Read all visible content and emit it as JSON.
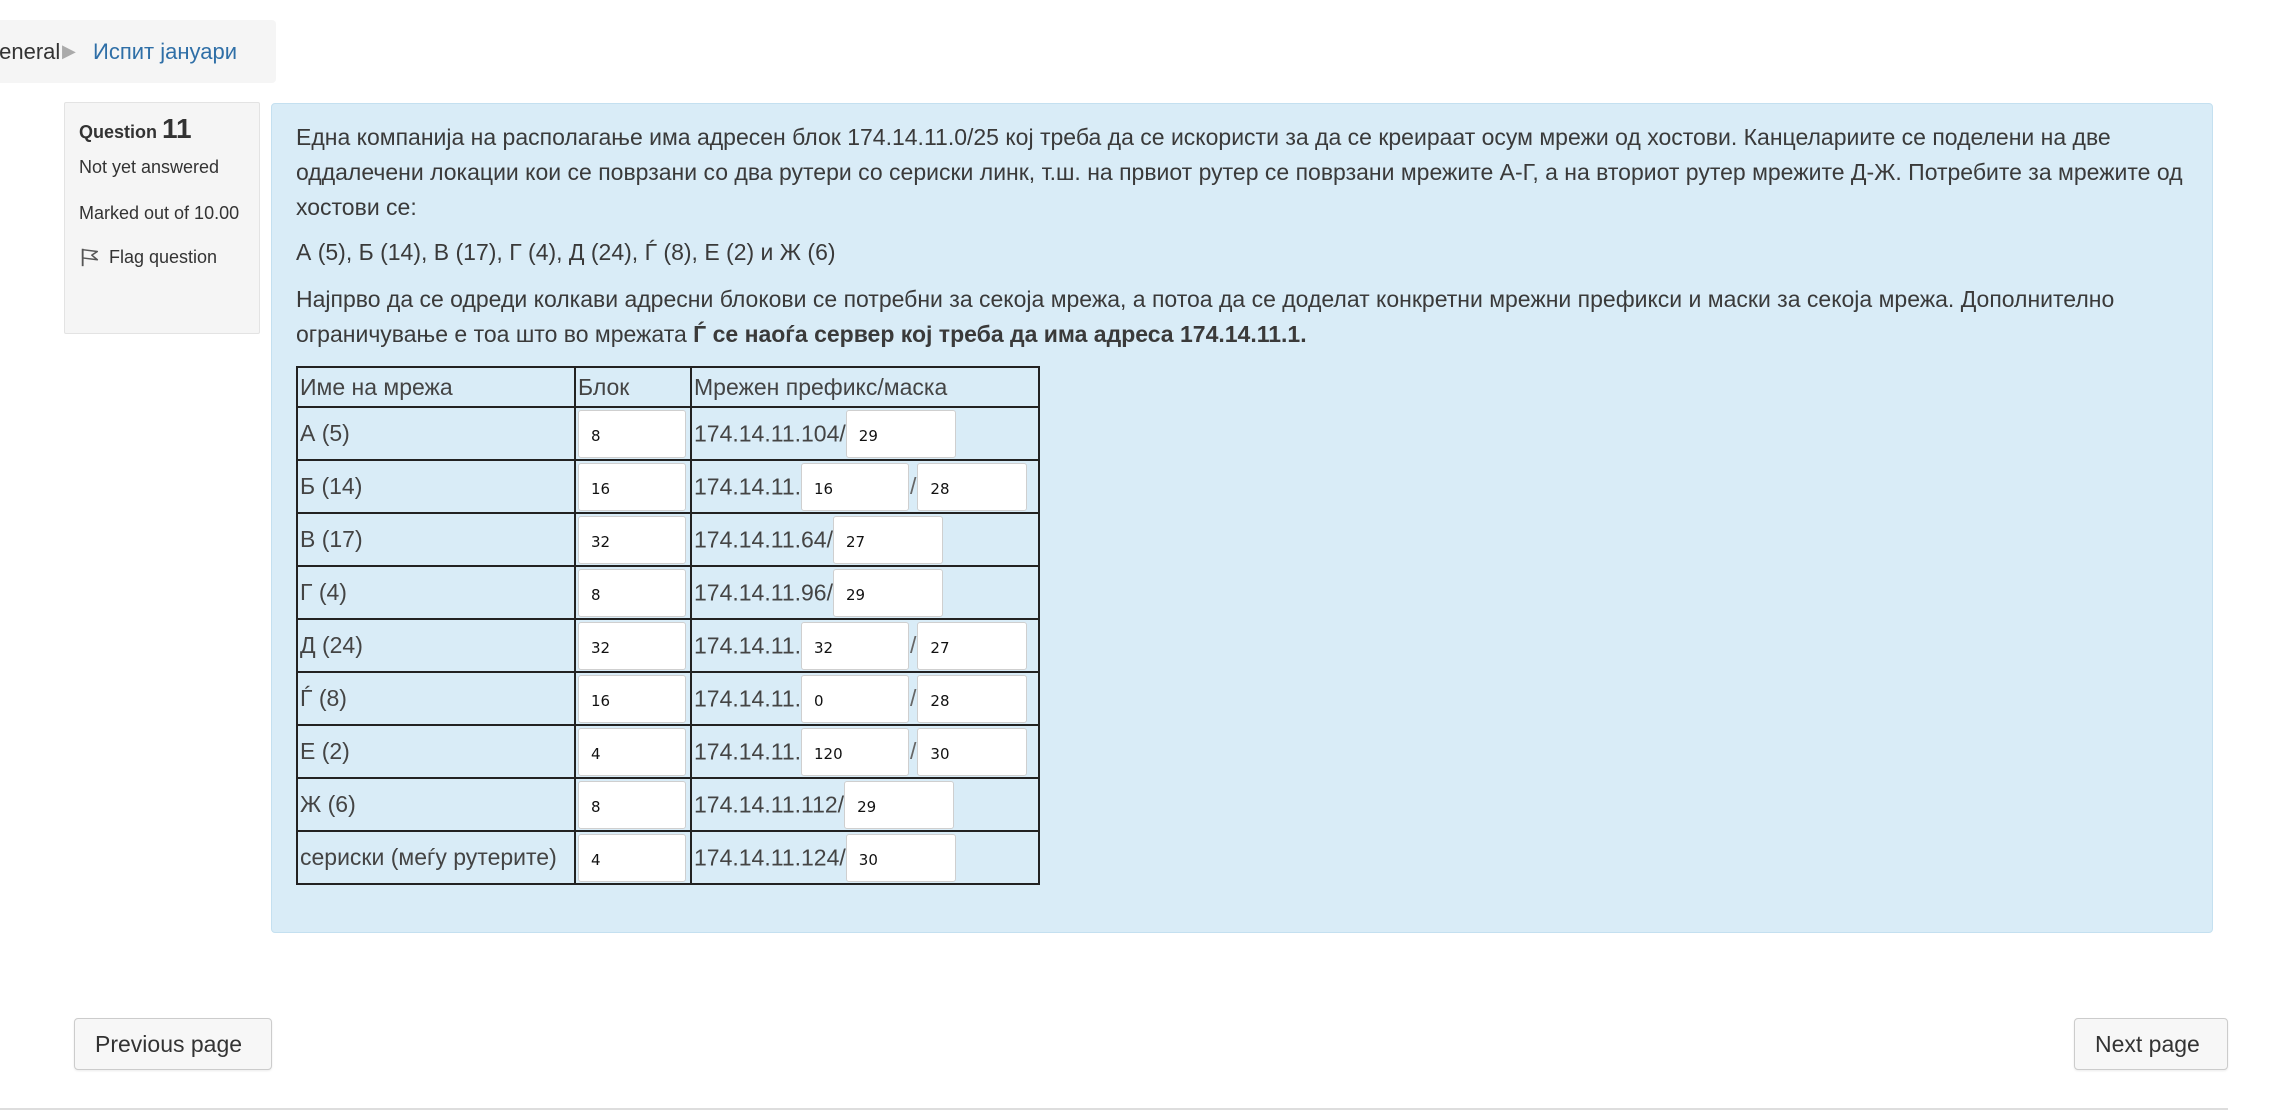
{
  "breadcrumb": {
    "previous": "General",
    "separator": "▶",
    "current": "Испит јануари"
  },
  "question_info": {
    "label": "Question",
    "number": "11",
    "state": "Not yet answered",
    "grade": "Marked out of 10.00",
    "flag_label": "Flag question",
    "flag_icon": "flag-icon"
  },
  "question": {
    "paragraph1": "Една компанија на располагање има адресен блок 174.14.11.0/25 кој треба да се искористи за да се креираат осум мрежи од хостови. Канцелариите се поделени на две оддалечени локации кои се поврзани со два рутери со сериски линк, т.ш. на првиот рутер се поврзани мрежите А-Г, а на вториот рутер мрежите Д-Ж. Потребите за мрежите од хостови се:",
    "paragraph2": "А (5), Б (14), В (17), Г (4), Д (24), Ѓ (8), Е (2) и Ж (6)",
    "paragraph3_text": "Најпрво да се одреди колкави адресни блокови се потребни за секоја мрежа, а потоа да се доделат конкретни мрежни префикси и маски за секоја мрежа. Дополнително ограничување е тоа што во мрежата ",
    "paragraph3_bold": "Ѓ се наоѓа сервер кој треба да има адреса 174.14.11.1."
  },
  "table": {
    "headers": [
      "Име на мрежа",
      "Блок",
      "Мрежен префикс/маска"
    ],
    "rows": [
      {
        "name": "А (5)",
        "block": "8",
        "prefix_text": "174.14.11.104/",
        "mask": "29"
      },
      {
        "name": "Б (14)",
        "block": "16",
        "prefix_text": "174.14.11.",
        "octet": "16",
        "mask": "28"
      },
      {
        "name": "В (17)",
        "block": "32",
        "prefix_text": "174.14.11.64/",
        "mask": "27"
      },
      {
        "name": "Г (4)",
        "block": "8",
        "prefix_text": "174.14.11.96/",
        "mask": "29"
      },
      {
        "name": "Д (24)",
        "block": "32",
        "prefix_text": "174.14.11.",
        "octet": "32",
        "mask": "27"
      },
      {
        "name": "Ѓ (8)",
        "block": "16",
        "prefix_text": "174.14.11.",
        "octet": "0",
        "mask": "28"
      },
      {
        "name": "Е (2)",
        "block": "4",
        "prefix_text": "174.14.11.",
        "octet": "120",
        "mask": "30"
      },
      {
        "name": "Ж (6)",
        "block": "8",
        "prefix_text": "174.14.11.112/",
        "mask": "29"
      },
      {
        "name": "сериски (меѓу рутерите)",
        "block": "4",
        "prefix_text": "174.14.11.124/",
        "mask": "30"
      }
    ],
    "slash": "/"
  },
  "navigation": {
    "previous_label": "Previous page",
    "next_label": "Next page"
  },
  "colors": {
    "content_bg": "#d9ecf7",
    "link": "#2f6fa7",
    "info_bg": "#f5f5f5"
  }
}
